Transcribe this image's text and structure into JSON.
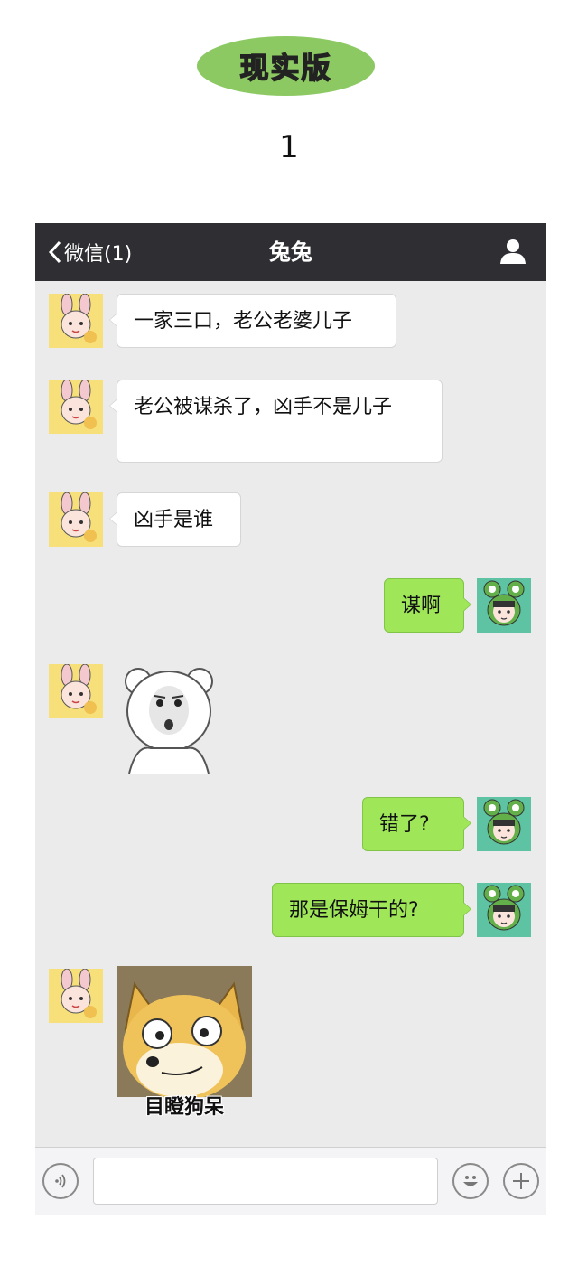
{
  "header": {
    "badge_label": "现实版",
    "page_number": "1"
  },
  "chat": {
    "back_label": "微信(1)",
    "title": "兔兔",
    "messages": [
      {
        "side": "in",
        "type": "text",
        "text": "一家三口，老公老婆儿子"
      },
      {
        "side": "in",
        "type": "text",
        "text": "老公被谋杀了，凶手不是儿子"
      },
      {
        "side": "in",
        "type": "text",
        "text": "凶手是谁"
      },
      {
        "side": "out",
        "type": "text",
        "text": "谋啊"
      },
      {
        "side": "in",
        "type": "sticker",
        "sticker": "shocked-bear-sticker"
      },
      {
        "side": "out",
        "type": "text",
        "text": "错了?"
      },
      {
        "side": "out",
        "type": "text",
        "text": "那是保姆干的?"
      },
      {
        "side": "in",
        "type": "sticker",
        "sticker": "doge-sticker",
        "caption": "目瞪狗呆"
      }
    ]
  },
  "input_bar": {
    "voice_icon": "voice-icon",
    "emoji_icon": "emoji-icon",
    "plus_icon": "plus-icon"
  },
  "colors": {
    "badge": "#8cc963",
    "navbar": "#2e2e33",
    "chat_bg": "#ebebeb",
    "outgoing_bubble": "#9fe658",
    "incoming_bubble": "#ffffff"
  }
}
